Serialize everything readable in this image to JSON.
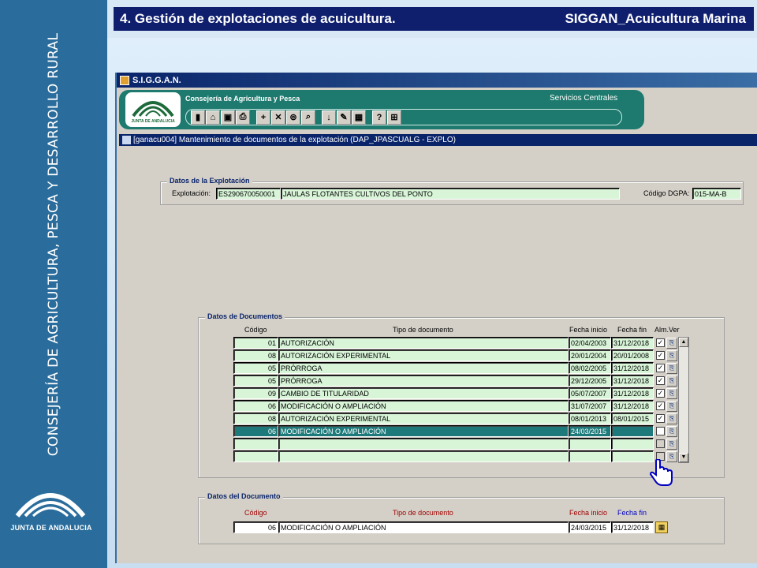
{
  "sidebar": {
    "vertical_text": "CONSEJERÍA DE AGRICULTURA, PESCA Y DESARROLLO RURAL",
    "logo_text": "JUNTA DE ANDALUCIA"
  },
  "header": {
    "title": "4. Gestión de explotaciones de acuicultura.",
    "system": "SIGGAN_Acuicultura Marina"
  },
  "window": {
    "title": "S.I.G.G.A.N.",
    "banner_left": "Consejería de Agricultura y Pesca",
    "banner_right": "Servicios Centrales",
    "banner_logo_text": "JUNTA DE ANDALUCIA",
    "form_title": "[ganacu004] Mantenimiento de documentos de la explotación  (DAP_JPASCUALG - EXPLO)"
  },
  "toolbar": {
    "buttons": [
      {
        "name": "exit",
        "glyph": "▮"
      },
      {
        "name": "open-folder",
        "glyph": "⌂"
      },
      {
        "name": "save",
        "glyph": "▣"
      },
      {
        "name": "print",
        "glyph": "⎙"
      },
      {
        "name": "insert",
        "glyph": "+"
      },
      {
        "name": "delete",
        "glyph": "✕"
      },
      {
        "name": "search",
        "glyph": "⊚"
      },
      {
        "name": "query",
        "glyph": "⌕"
      },
      {
        "name": "download",
        "glyph": "↓"
      },
      {
        "name": "edit",
        "glyph": "✎"
      },
      {
        "name": "calendar",
        "glyph": "▦"
      },
      {
        "name": "help",
        "glyph": "?"
      },
      {
        "name": "tree",
        "glyph": "⊞"
      }
    ]
  },
  "explotacion": {
    "legend": "Datos de la Explotación",
    "label": "Explotación:",
    "code": "ES290670050001",
    "name": "JAULAS FLOTANTES CULTIVOS DEL PONTO",
    "dgpa_label": "Código DGPA:",
    "dgpa_value": "015-MA-B"
  },
  "documentos": {
    "legend": "Datos de Documentos",
    "columns": {
      "codigo": "Código",
      "tipo": "Tipo de documento",
      "fecha_inicio": "Fecha inicio",
      "fecha_fin": "Fecha fin",
      "alm_ver": "Alm.Ver"
    },
    "rows": [
      {
        "codigo": "01",
        "tipo": "AUTORIZACIÓN",
        "inicio": "02/04/2003",
        "fin": "31/12/2018",
        "alm": "✓"
      },
      {
        "codigo": "08",
        "tipo": "AUTORIZACIÓN EXPERIMENTAL",
        "inicio": "20/01/2004",
        "fin": "20/01/2008",
        "alm": "✓"
      },
      {
        "codigo": "05",
        "tipo": "PRÓRROGA",
        "inicio": "08/02/2005",
        "fin": "31/12/2018",
        "alm": "✓"
      },
      {
        "codigo": "05",
        "tipo": "PRÓRROGA",
        "inicio": "29/12/2005",
        "fin": "31/12/2018",
        "alm": "✓"
      },
      {
        "codigo": "09",
        "tipo": "CAMBIO DE TITULARIDAD",
        "inicio": "05/07/2007",
        "fin": "31/12/2018",
        "alm": "✓"
      },
      {
        "codigo": "06",
        "tipo": "MODIFICACIÓN O AMPLIACIÓN",
        "inicio": "31/07/2007",
        "fin": "31/12/2018",
        "alm": "✓"
      },
      {
        "codigo": "08",
        "tipo": "AUTORIZACIÓN EXPERIMENTAL",
        "inicio": "08/01/2013",
        "fin": "08/01/2015",
        "alm": "✓"
      },
      {
        "codigo": "06",
        "tipo": "MODIFICACIÓN O AMPLIACIÓN",
        "inicio": "24/03/2015",
        "fin": "",
        "alm": ""
      },
      {
        "codigo": "",
        "tipo": "",
        "inicio": "",
        "fin": "",
        "alm": ""
      },
      {
        "codigo": "",
        "tipo": "",
        "inicio": "",
        "fin": "",
        "alm": ""
      }
    ]
  },
  "documento": {
    "legend": "Datos del Documento",
    "col_codigo": "Código",
    "col_tipo": "Tipo de documento",
    "col_inicio": "Fecha inicio",
    "col_fin": "Fecha fin",
    "codigo": "06",
    "tipo": "MODIFICACIÓN O AMPLIACIÓN",
    "inicio": "24/03/2015",
    "fin": "31/12/2018"
  }
}
